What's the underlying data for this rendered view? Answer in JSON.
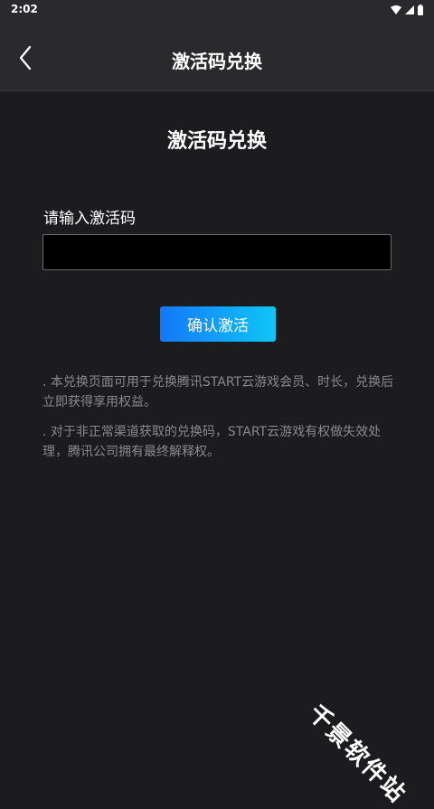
{
  "status_bar": {
    "time": "2:02",
    "icons": [
      "wifi-icon",
      "signal-icon",
      "battery-icon"
    ]
  },
  "header": {
    "back_icon": "chevron-left-icon",
    "title": "激活码兑换"
  },
  "main": {
    "title": "激活码兑换",
    "input_label": "请输入激活码",
    "input_value": "",
    "input_placeholder": "",
    "confirm_label": "确认激活",
    "notes": [
      ". 本兑换页面可用于兑换腾讯START云游戏会员、时长，兑换后立即获得享用权益。",
      ". 对于非正常渠道获取的兑换码，START云游戏有权做失效处理，腾讯公司拥有最终解释权。"
    ]
  },
  "watermark": "千景软件站",
  "colors": {
    "background": "#1c1c1e",
    "header_background": "#2a2a2c",
    "button_gradient_start": "#1378f9",
    "button_gradient_end": "#10c6f6",
    "note_text": "#8a8a8e"
  }
}
